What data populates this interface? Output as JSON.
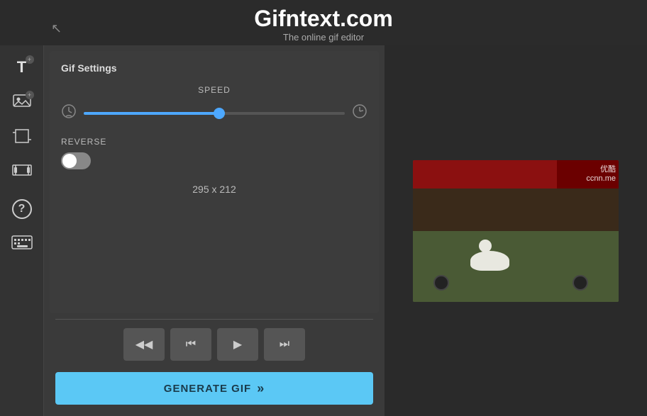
{
  "header": {
    "title": "Gifntext.com",
    "subtitle": "The online gif editor"
  },
  "sidebar": {
    "items": [
      {
        "id": "add-text",
        "icon": "T",
        "badge": "+",
        "label": "Add Text"
      },
      {
        "id": "add-image",
        "icon": "🖼",
        "badge": "+",
        "label": "Add Image"
      },
      {
        "id": "crop",
        "icon": "⊡",
        "badge": null,
        "label": "Crop"
      },
      {
        "id": "trim",
        "icon": "✂",
        "badge": null,
        "label": "Trim Frames"
      },
      {
        "id": "help",
        "icon": "?",
        "badge": null,
        "label": "Help"
      },
      {
        "id": "keyboard",
        "icon": "⌨",
        "badge": null,
        "label": "Keyboard Shortcuts"
      }
    ]
  },
  "gif_settings": {
    "panel_title": "Gif Settings",
    "speed": {
      "label": "SPEED",
      "value": 52,
      "min": 0,
      "max": 100
    },
    "reverse": {
      "label": "REVERSE",
      "enabled": false
    },
    "dimensions": "295 x 212"
  },
  "playback": {
    "buttons": [
      {
        "id": "rewind",
        "icon": "⏪",
        "label": "Rewind"
      },
      {
        "id": "prev-frame",
        "icon": "⏮",
        "label": "Previous Frame"
      },
      {
        "id": "play",
        "icon": "▶",
        "label": "Play"
      },
      {
        "id": "next-frame",
        "icon": "⏭",
        "label": "Next Frame"
      }
    ]
  },
  "generate_btn": {
    "label": "GENERATE GIF",
    "icon": "»"
  },
  "preview": {
    "watermark_line1": "优酷",
    "watermark_line2": "ccnn.me"
  }
}
